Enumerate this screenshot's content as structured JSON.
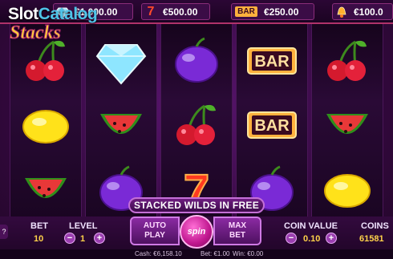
{
  "watermark": {
    "part1": "Slot",
    "part2": "Catalog"
  },
  "paytable": [
    {
      "symbol": "diamond-icon",
      "value": "€1,000.00"
    },
    {
      "symbol": "seven-icon",
      "value": "€500.00"
    },
    {
      "symbol": "bar-icon",
      "label": "BAR",
      "value": "€250.00"
    },
    {
      "symbol": "bell-icon",
      "value": "€100.0"
    }
  ],
  "reels": [
    [
      "cherry-icon",
      "lemon-icon",
      "watermelon-icon"
    ],
    [
      "diamond-icon",
      "watermelon-icon",
      "plum-icon"
    ],
    [
      "plum-icon",
      "cherry-icon",
      "seven-icon"
    ],
    [
      "bar-icon",
      "bar-icon",
      "plum-icon"
    ],
    [
      "cherry-icon",
      "watermelon-icon",
      "lemon-icon"
    ]
  ],
  "bar_label": "BAR",
  "banner": "STACKED WILDS IN FREE",
  "bet": {
    "label": "BET",
    "value": "10"
  },
  "level": {
    "label": "LEVEL",
    "value": "1",
    "minus": "−",
    "plus": "+"
  },
  "autoplay": {
    "line1": "AUTO",
    "line2": "PLAY"
  },
  "spin_label": "spin",
  "maxbet": {
    "line1": "MAX",
    "line2": "BET"
  },
  "coin_value": {
    "label": "COIN VALUE",
    "value": "0.10",
    "minus": "−",
    "plus": "+"
  },
  "coins": {
    "label": "COINS",
    "value": "61581"
  },
  "status": {
    "cash": "Cash: €6,158.10",
    "bet": "Bet: €1.00",
    "win": "Win: €0.00"
  },
  "side_marks": {
    "top": "?",
    "bottom": "?"
  },
  "colors": {
    "accent": "#ffd24a",
    "frame": "#b0326a"
  }
}
